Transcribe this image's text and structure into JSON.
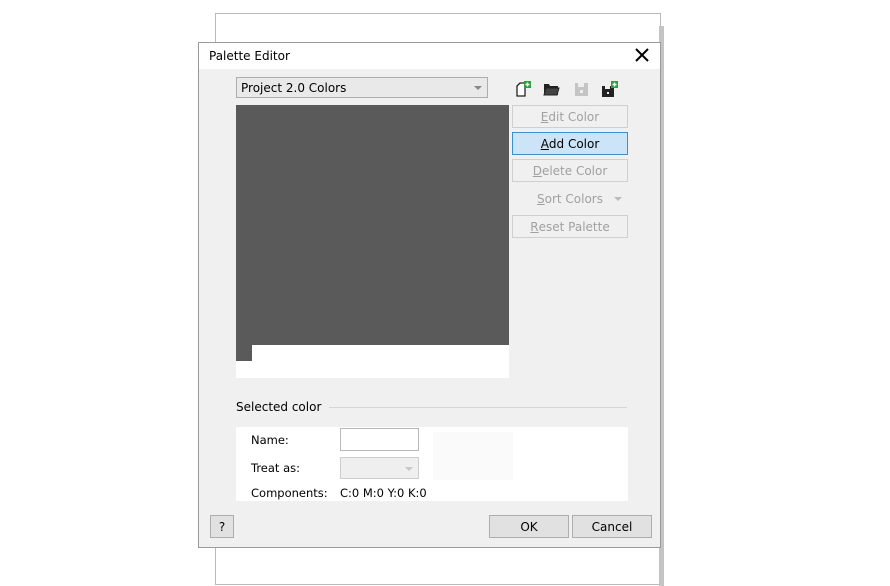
{
  "dialog": {
    "title": "Palette Editor",
    "close_icon": "close-icon"
  },
  "palette_select": {
    "selected": "Project 2.0 Colors"
  },
  "toolbar": {
    "icons": [
      "new-palette-icon",
      "open-palette-icon",
      "save-palette-icon",
      "save-as-palette-icon"
    ]
  },
  "palette": {
    "swatches": [
      {
        "color": "#5a5a5a",
        "selected": true
      }
    ]
  },
  "actions": {
    "edit_color": {
      "label_u": "E",
      "label_rest": "dit Color",
      "enabled": false
    },
    "add_color": {
      "label_u": "A",
      "label_rest": "dd Color",
      "enabled": true
    },
    "delete_color": {
      "label_u": "D",
      "label_rest": "elete Color",
      "enabled": false
    },
    "sort_colors": {
      "label_u": "S",
      "label_rest": "ort Colors",
      "enabled": false
    },
    "reset_palette": {
      "label_u": "R",
      "label_rest": "eset Palette",
      "enabled": false
    }
  },
  "selected_color": {
    "heading": "Selected color",
    "name_label": "Name:",
    "name_value": "",
    "treat_as_label": "Treat as:",
    "treat_as_value": "",
    "components_label": "Components:",
    "components_value": "C:0 M:0 Y:0 K:0"
  },
  "footer": {
    "help_label": "?",
    "ok_label": "OK",
    "cancel_label": "Cancel"
  },
  "colors": {
    "accent": "#3c8fd0",
    "accent_bg": "#cce4f7",
    "palette_swatch": "#5a5a5a",
    "dialog_bg": "#f0f0f0"
  }
}
